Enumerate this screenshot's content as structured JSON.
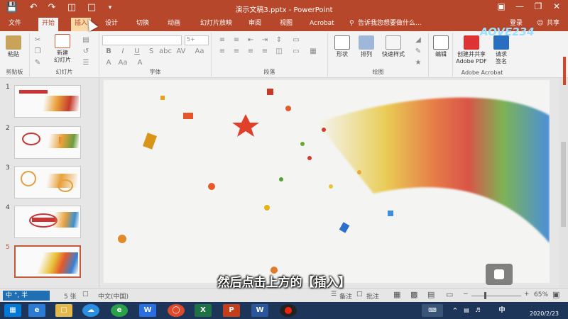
{
  "window": {
    "title": "演示文稿3.pptx - PowerPoint"
  },
  "quick_access": [
    "save-icon",
    "undo-icon",
    "redo-icon",
    "present-icon",
    "new-doc-icon",
    "customize-icon"
  ],
  "tabs": [
    {
      "label": "文件"
    },
    {
      "label": "开始"
    },
    {
      "label": "插入"
    },
    {
      "label": "设计"
    },
    {
      "label": "切换"
    },
    {
      "label": "动画"
    },
    {
      "label": "幻灯片放映"
    },
    {
      "label": "审阅"
    },
    {
      "label": "视图"
    },
    {
      "label": "Acrobat"
    }
  ],
  "tell_me": "告诉我您想要做什么...",
  "account": {
    "login": "登录",
    "share": "共享"
  },
  "ribbon": {
    "paste": "粘贴",
    "clipboard": "剪贴板",
    "new_slide_line1": "新建",
    "new_slide_line2": "幻灯片",
    "slides": "幻灯片",
    "font_size": "5+",
    "font": "字体",
    "paragraph": "段落",
    "shapes": "形状",
    "arrange": "排列",
    "quick_styles": "快速样式",
    "drawing": "绘图",
    "edit": "编辑",
    "create_share_line1": "创建并共享",
    "create_share_line2": "Adobe PDF",
    "request_sign_line1": "请求",
    "request_sign_line2": "签名",
    "acrobat": "Adobe Acrobat"
  },
  "slides": [
    {
      "num": "1"
    },
    {
      "num": "2"
    },
    {
      "num": "3"
    },
    {
      "num": "4"
    },
    {
      "num": "5"
    }
  ],
  "status": {
    "slide_count": "5 张",
    "language": "中文(中国)",
    "notes": "备注",
    "comments": "批注",
    "zoom": "65%"
  },
  "subtitle": "然后点击上方的【插入】",
  "ime": "中 °, 半",
  "watermark": "AOVE234",
  "clock": {
    "date": "2020/2/23"
  },
  "colors": {
    "accent": "#b7472a",
    "taskbar": "#1d3558"
  }
}
